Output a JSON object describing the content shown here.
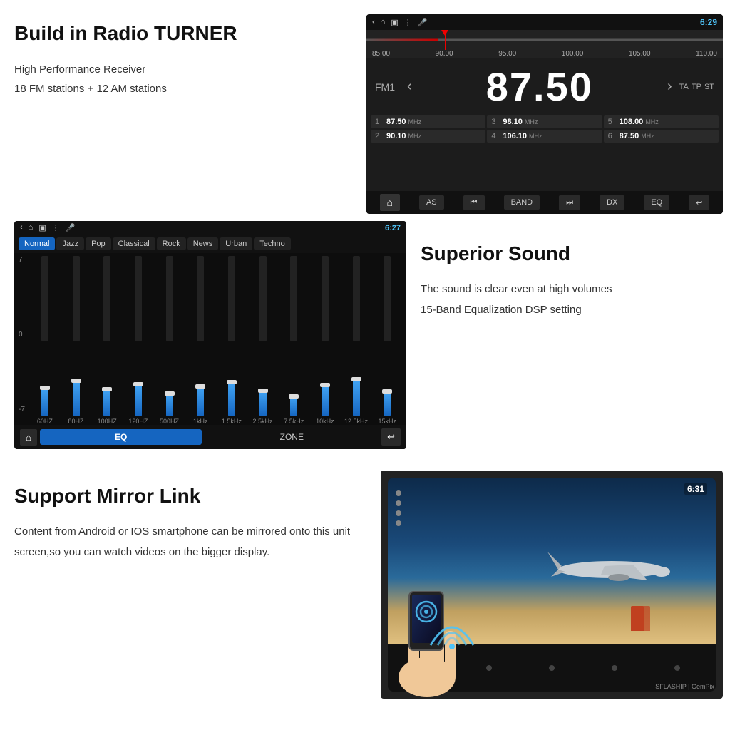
{
  "top": {
    "title": "Build in Radio TURNER",
    "desc_line1": "High Performance Receiver",
    "desc_line2": "18 FM stations + 12 AM stations",
    "radio": {
      "time": "6:29",
      "band": "FM1",
      "frequency": "87.50",
      "rds_tags": [
        "TA",
        "TP",
        "ST"
      ],
      "tuner_labels": [
        "85.00",
        "90.00",
        "95.00",
        "100.00",
        "105.00",
        "110.00"
      ],
      "presets": [
        {
          "num": "1",
          "freq": "87.50",
          "unit": "MHz"
        },
        {
          "num": "3",
          "freq": "98.10",
          "unit": "MHz"
        },
        {
          "num": "5",
          "freq": "108.00",
          "unit": "MHz"
        },
        {
          "num": "2",
          "freq": "90.10",
          "unit": "MHz"
        },
        {
          "num": "4",
          "freq": "106.10",
          "unit": "MHz"
        },
        {
          "num": "6",
          "freq": "87.50",
          "unit": "MHz"
        }
      ],
      "controls": [
        "AS",
        "◀◀",
        "BAND",
        "▶▶",
        "DX",
        "EQ"
      ]
    }
  },
  "mid": {
    "eq": {
      "time": "6:27",
      "presets": [
        {
          "label": "Normal",
          "active": true
        },
        {
          "label": "Jazz",
          "active": false
        },
        {
          "label": "Pop",
          "active": false
        },
        {
          "label": "Classical",
          "active": false
        },
        {
          "label": "Rock",
          "active": false
        },
        {
          "label": "News",
          "active": false
        },
        {
          "label": "Urban",
          "active": false
        },
        {
          "label": "Techno",
          "active": false
        }
      ],
      "scale": [
        "7",
        "0",
        "-7"
      ],
      "bands": [
        {
          "label": "60HZ",
          "height": 65,
          "fill_height": 40
        },
        {
          "label": "80HZ",
          "height": 72,
          "fill_height": 50
        },
        {
          "label": "100HZ",
          "height": 60,
          "fill_height": 38
        },
        {
          "label": "120HZ",
          "height": 68,
          "fill_height": 45
        },
        {
          "label": "500HZ",
          "height": 55,
          "fill_height": 32
        },
        {
          "label": "1kHz",
          "height": 62,
          "fill_height": 42
        },
        {
          "label": "1.5kHz",
          "height": 70,
          "fill_height": 48
        },
        {
          "label": "2.5kHz",
          "height": 58,
          "fill_height": 36
        },
        {
          "label": "7.5kHz",
          "height": 50,
          "fill_height": 28
        },
        {
          "label": "10kHz",
          "height": 64,
          "fill_height": 44
        },
        {
          "label": "12.5kHz",
          "height": 75,
          "fill_height": 52
        },
        {
          "label": "15kHz",
          "height": 57,
          "fill_height": 35
        }
      ],
      "bottom": {
        "eq_label": "EQ",
        "zone_label": "ZONE"
      }
    },
    "title": "Superior Sound",
    "desc_line1": "The sound is clear even at high volumes",
    "desc_line2": "15-Band Equalization DSP setting"
  },
  "bottom": {
    "title": "Support Mirror Link",
    "desc": "Content from Android or IOS smartphone can be mirrored onto this unit screen,so you can watch videos on the  bigger display.",
    "mirror": {
      "time": "6:31",
      "watermark": "SFLASHIP | GemPix"
    }
  },
  "icons": {
    "back": "‹",
    "home": "⌂",
    "bluetooth": "Ⓑ",
    "wifi": "📶",
    "arrow_left": "‹",
    "arrow_right": "›"
  }
}
